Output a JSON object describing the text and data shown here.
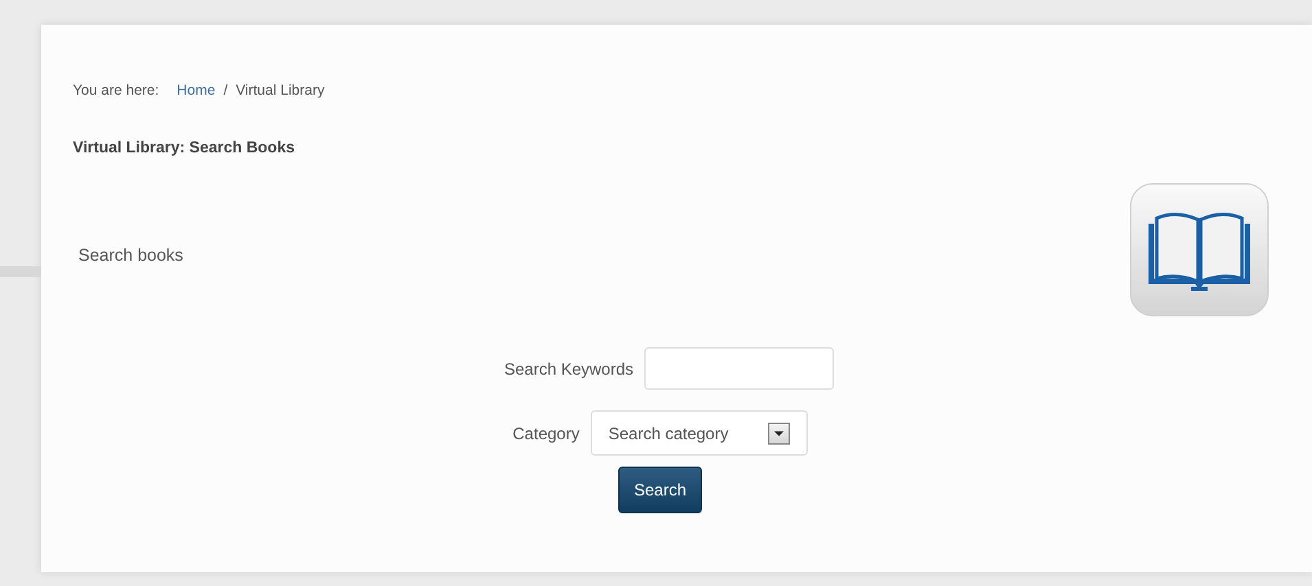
{
  "breadcrumb": {
    "prefix": "You are here:",
    "items": [
      {
        "label": "Home",
        "kind": "link"
      },
      {
        "label": "/",
        "kind": "separator"
      },
      {
        "label": "Virtual Library",
        "kind": "current"
      }
    ]
  },
  "page_title": "Virtual Library: Search Books",
  "section_label": "Search books",
  "form": {
    "keywords": {
      "label": "Search Keywords"
    },
    "category": {
      "label": "Category",
      "value": "Search category"
    },
    "submit": "Search"
  }
}
